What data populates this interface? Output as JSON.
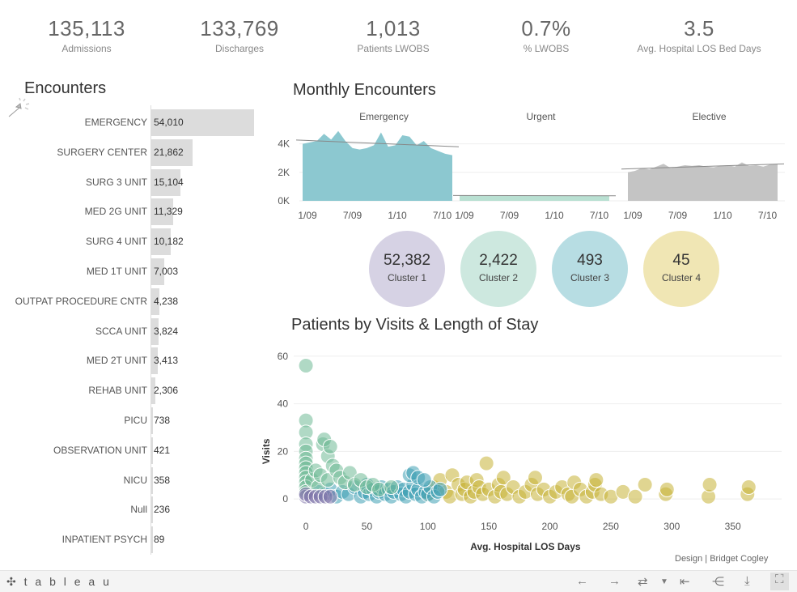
{
  "kpis": [
    {
      "value": "135,113",
      "label": "Admissions"
    },
    {
      "value": "133,769",
      "label": "Discharges"
    },
    {
      "value": "1,013",
      "label": "Patients LWOBS"
    },
    {
      "value": "0.7%",
      "label": "% LWOBS"
    },
    {
      "value": "3.5",
      "label": "Avg. Hospital LOS Bed Days"
    }
  ],
  "encounters": {
    "title": "Encounters",
    "items": [
      {
        "label": "EMERGENCY",
        "value": "54,010",
        "num": 54010
      },
      {
        "label": "SURGERY CENTER",
        "value": "21,862",
        "num": 21862
      },
      {
        "label": "SURG 3 UNIT",
        "value": "15,104",
        "num": 15104
      },
      {
        "label": "MED 2G UNIT",
        "value": "11,329",
        "num": 11329
      },
      {
        "label": "SURG 4 UNIT",
        "value": "10,182",
        "num": 10182
      },
      {
        "label": "MED 1T UNIT",
        "value": "7,003",
        "num": 7003
      },
      {
        "label": "OUTPAT PROCEDURE CNTR",
        "value": "4,238",
        "num": 4238
      },
      {
        "label": "SCCA UNIT",
        "value": "3,824",
        "num": 3824
      },
      {
        "label": "MED 2T UNIT",
        "value": "3,413",
        "num": 3413
      },
      {
        "label": "REHAB UNIT",
        "value": "2,306",
        "num": 2306
      },
      {
        "label": "PICU",
        "value": "738",
        "num": 738
      },
      {
        "label": "OBSERVATION UNIT",
        "value": "421",
        "num": 421
      },
      {
        "label": "NICU",
        "value": "358",
        "num": 358
      },
      {
        "label": "Null",
        "value": "236",
        "num": 236
      },
      {
        "label": "INPATIENT PSYCH",
        "value": "89",
        "num": 89
      }
    ]
  },
  "monthly": {
    "title": "Monthly Encounters",
    "yticks": [
      "4K",
      "2K",
      "0K"
    ],
    "panels": [
      {
        "name": "Emergency",
        "color": "#8cc8d0",
        "xticks": [
          "1/09",
          "7/09",
          "1/10",
          "7/10"
        ]
      },
      {
        "name": "Urgent",
        "color": "#b9e0d2",
        "xticks": [
          "1/09",
          "7/09",
          "1/10",
          "7/10"
        ]
      },
      {
        "name": "Elective",
        "color": "#c4c4c4",
        "xticks": [
          "1/09",
          "7/09",
          "1/10",
          "7/10"
        ]
      }
    ]
  },
  "clusters": [
    {
      "value": "52,382",
      "label": "Cluster 1",
      "color": "#d6d2e4"
    },
    {
      "value": "2,422",
      "label": "Cluster 2",
      "color": "#cde8df"
    },
    {
      "value": "493",
      "label": "Cluster 3",
      "color": "#b7dde3"
    },
    {
      "value": "45",
      "label": "Cluster 4",
      "color": "#f0e6b4"
    }
  ],
  "scatter_title": "Patients by Visits & Length of Stay",
  "credit": "Design | Bridget Cogley",
  "footer": {
    "logo": "✣ t a b l e a u"
  },
  "chart_data": [
    {
      "type": "area",
      "title": "Monthly Encounters",
      "x": [
        "1/09",
        "2/09",
        "3/09",
        "4/09",
        "5/09",
        "6/09",
        "7/09",
        "8/09",
        "9/09",
        "10/09",
        "11/09",
        "12/09",
        "1/10",
        "2/10",
        "3/10",
        "4/10",
        "5/10",
        "6/10",
        "7/10",
        "8/10",
        "9/10",
        "10/10"
      ],
      "xticks": [
        "1/09",
        "7/09",
        "1/10",
        "7/10"
      ],
      "ylim": [
        0,
        5000
      ],
      "yticks": [
        "4K",
        "2K",
        "0K"
      ],
      "series": [
        {
          "name": "Emergency",
          "values": [
            4000,
            4100,
            4200,
            4700,
            4300,
            4900,
            4200,
            3700,
            3600,
            3700,
            3900,
            4800,
            3800,
            3900,
            4600,
            4500,
            3900,
            4200,
            3700,
            3500,
            3300,
            3200
          ]
        },
        {
          "name": "Urgent",
          "values": [
            380,
            370,
            360,
            380,
            370,
            360,
            350,
            370,
            380,
            360,
            350,
            360,
            370,
            380,
            360,
            350,
            370,
            360,
            350,
            360,
            370,
            350
          ]
        },
        {
          "name": "Elective",
          "values": [
            2000,
            2100,
            2300,
            2200,
            2400,
            2600,
            2300,
            2400,
            2500,
            2450,
            2500,
            2400,
            2350,
            2450,
            2500,
            2400,
            2700,
            2450,
            2500,
            2400,
            2550,
            2600
          ]
        }
      ]
    },
    {
      "type": "scatter",
      "title": "Patients by Visits & Length of Stay",
      "xlabel": "Avg. Hospital LOS Days",
      "ylabel": "Visits",
      "xlim": [
        -10,
        390
      ],
      "ylim": [
        -3,
        64
      ],
      "xticks": [
        0,
        50,
        100,
        150,
        200,
        250,
        300,
        350
      ],
      "yticks": [
        0,
        20,
        40,
        60
      ],
      "series": [
        {
          "name": "Cluster 1",
          "color": "#7f74aa",
          "points": [
            [
              0,
              1
            ],
            [
              0,
              2
            ],
            [
              4,
              1
            ],
            [
              8,
              1
            ],
            [
              12,
              1
            ],
            [
              16,
              1
            ],
            [
              20,
              1
            ]
          ]
        },
        {
          "name": "Cluster 2",
          "color": "#6fb996",
          "points": [
            [
              0,
              56
            ],
            [
              0,
              33
            ],
            [
              0,
              28
            ],
            [
              0,
              23
            ],
            [
              0,
              20
            ],
            [
              0,
              17
            ],
            [
              0,
              15
            ],
            [
              0,
              13
            ],
            [
              0,
              11
            ],
            [
              0,
              9
            ],
            [
              0,
              7
            ],
            [
              0,
              5
            ],
            [
              0,
              3
            ],
            [
              5,
              8
            ],
            [
              8,
              12
            ],
            [
              10,
              5
            ],
            [
              12,
              10
            ],
            [
              14,
              23
            ],
            [
              15,
              25
            ],
            [
              18,
              18
            ],
            [
              18,
              8
            ],
            [
              20,
              22
            ],
            [
              22,
              14
            ],
            [
              25,
              12
            ],
            [
              28,
              9
            ],
            [
              32,
              7
            ],
            [
              36,
              11
            ],
            [
              40,
              6
            ],
            [
              45,
              8
            ],
            [
              50,
              5
            ],
            [
              55,
              6
            ],
            [
              60,
              4
            ],
            [
              70,
              5
            ]
          ]
        },
        {
          "name": "Cluster 3",
          "color": "#3fa0b4",
          "points": [
            [
              10,
              3
            ],
            [
              15,
              2
            ],
            [
              20,
              4
            ],
            [
              25,
              1
            ],
            [
              30,
              3
            ],
            [
              35,
              2
            ],
            [
              40,
              5
            ],
            [
              45,
              1
            ],
            [
              48,
              3
            ],
            [
              50,
              6
            ],
            [
              52,
              2
            ],
            [
              55,
              4
            ],
            [
              58,
              1
            ],
            [
              60,
              3
            ],
            [
              62,
              5
            ],
            [
              65,
              2
            ],
            [
              68,
              4
            ],
            [
              70,
              1
            ],
            [
              72,
              3
            ],
            [
              75,
              5
            ],
            [
              78,
              2
            ],
            [
              80,
              4
            ],
            [
              82,
              1
            ],
            [
              85,
              3
            ],
            [
              88,
              6
            ],
            [
              90,
              2
            ],
            [
              92,
              4
            ],
            [
              95,
              1
            ],
            [
              98,
              3
            ],
            [
              100,
              2
            ],
            [
              102,
              5
            ],
            [
              105,
              1
            ],
            [
              108,
              3
            ],
            [
              110,
              4
            ],
            [
              85,
              10
            ],
            [
              88,
              11
            ],
            [
              92,
              9
            ],
            [
              97,
              8
            ]
          ]
        },
        {
          "name": "Cluster 4",
          "color": "#c7b236",
          "points": [
            [
              100,
              2
            ],
            [
              105,
              5
            ],
            [
              110,
              8
            ],
            [
              115,
              3
            ],
            [
              118,
              1
            ],
            [
              120,
              10
            ],
            [
              125,
              6
            ],
            [
              128,
              2
            ],
            [
              130,
              4
            ],
            [
              132,
              7
            ],
            [
              135,
              1
            ],
            [
              138,
              3
            ],
            [
              140,
              8
            ],
            [
              142,
              5
            ],
            [
              145,
              2
            ],
            [
              148,
              15
            ],
            [
              150,
              4
            ],
            [
              155,
              1
            ],
            [
              158,
              6
            ],
            [
              160,
              3
            ],
            [
              162,
              9
            ],
            [
              165,
              2
            ],
            [
              170,
              5
            ],
            [
              175,
              1
            ],
            [
              180,
              3
            ],
            [
              185,
              6
            ],
            [
              188,
              9
            ],
            [
              190,
              2
            ],
            [
              195,
              4
            ],
            [
              200,
              1
            ],
            [
              205,
              3
            ],
            [
              210,
              5
            ],
            [
              215,
              2
            ],
            [
              218,
              1
            ],
            [
              220,
              7
            ],
            [
              225,
              4
            ],
            [
              230,
              1
            ],
            [
              235,
              3
            ],
            [
              237,
              6
            ],
            [
              238,
              8
            ],
            [
              242,
              2
            ],
            [
              250,
              1
            ],
            [
              260,
              3
            ],
            [
              270,
              1
            ],
            [
              278,
              6
            ],
            [
              295,
              2
            ],
            [
              296,
              4
            ],
            [
              330,
              1
            ],
            [
              331,
              6
            ],
            [
              362,
              2
            ],
            [
              363,
              5
            ]
          ]
        }
      ]
    }
  ]
}
